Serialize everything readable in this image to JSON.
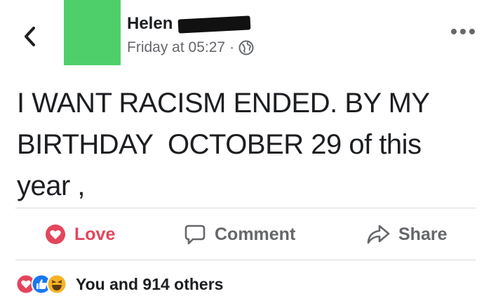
{
  "post": {
    "author_name": "Helen",
    "timestamp": "Friday at 05:27",
    "separator": "·",
    "privacy_icon": "globe-icon",
    "text": "I WANT RACISM ENDED. BY MY\nBIRTHDAY  OCTOBER 29 of this\nyear ,"
  },
  "actions": {
    "love_label": "Love",
    "comment_label": "Comment",
    "share_label": "Share"
  },
  "reactions": {
    "summary": "You and 914 others",
    "icons": [
      "love-reaction-icon",
      "like-reaction-icon",
      "haha-reaction-icon"
    ]
  },
  "colors": {
    "love": "#e4455b",
    "like": "#1877f2",
    "haha": "#f7b125",
    "avatar": "#4fcf6a",
    "secondary_text": "#65676b"
  }
}
